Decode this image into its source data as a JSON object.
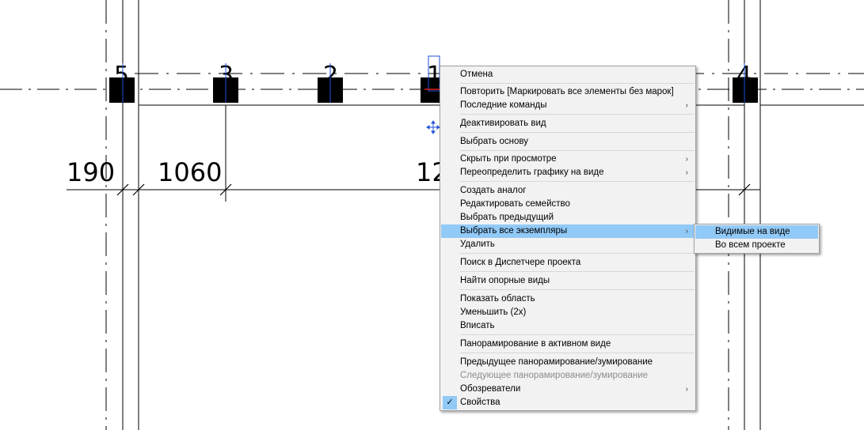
{
  "drawing": {
    "grid_tags": [
      "5",
      "3",
      "2",
      "1",
      "4"
    ],
    "dimensions": [
      "190",
      "1060",
      "12"
    ]
  },
  "context_menu": {
    "items": [
      {
        "label": "Отмена"
      },
      {
        "label": "Повторить [Маркировать все элементы без марок]"
      },
      {
        "label": "Последние команды",
        "submenu": true
      },
      {
        "label": "Деактивировать вид"
      },
      {
        "label": "Выбрать основу"
      },
      {
        "label": "Скрыть при просмотре",
        "submenu": true
      },
      {
        "label": "Переопределить графику на виде",
        "submenu": true
      },
      {
        "label": "Создать аналог"
      },
      {
        "label": "Редактировать семейство"
      },
      {
        "label": "Выбрать предыдущий"
      },
      {
        "label": "Выбрать все экземпляры",
        "submenu": true,
        "highlighted": true
      },
      {
        "label": "Удалить"
      },
      {
        "label": "Поиск в Диспетчере проекта"
      },
      {
        "label": "Найти опорные виды"
      },
      {
        "label": "Показать область"
      },
      {
        "label": "Уменьшить (2x)"
      },
      {
        "label": "Вписать"
      },
      {
        "label": "Панорамирование в активном виде"
      },
      {
        "label": "Предыдущее панорамирование/зумирование"
      },
      {
        "label": "Следующее панорамирование/зумирование",
        "disabled": true
      },
      {
        "label": "Обозреватели",
        "submenu": true
      },
      {
        "label": "Свойства",
        "checked": true
      }
    ],
    "submenu_arrow": "›",
    "check_mark": "✓"
  },
  "submenu": {
    "items": [
      {
        "label": "Видимые на виде",
        "highlighted": true
      },
      {
        "label": "Во всем проекте"
      }
    ]
  },
  "colors": {
    "highlight": "#91c9f7",
    "menu_bg": "#f2f2f2",
    "selection_blue": "#1f4fd8"
  }
}
